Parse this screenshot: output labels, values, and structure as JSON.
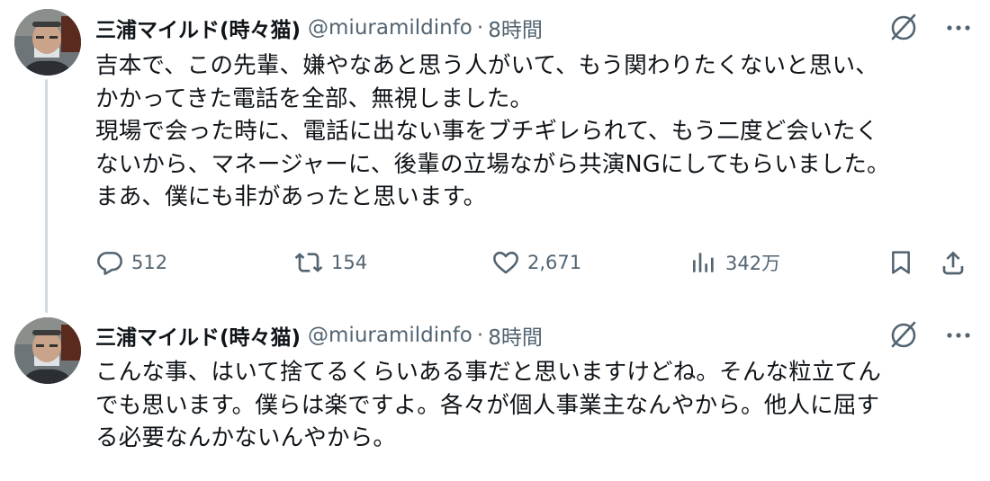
{
  "tweets": [
    {
      "name": "三浦マイルド(時々猫)",
      "handle": "@miuramildinfo",
      "separator": "·",
      "time": "8時間",
      "body": "吉本で、この先輩、嫌やなあと思う人がいて、もう関わりたくないと思い、\nかかってきた電話を全部、無視しました。\n現場で会った時に、電話に出ない事をブチギレられて、もう二度ど会いたく\nないから、マネージャーに、後輩の立場ながら共演NGにしてもらいました。\nまあ、僕にも非があったと思います。",
      "replies": "512",
      "retweets": "154",
      "likes": "2,671",
      "views": "342万"
    },
    {
      "name": "三浦マイルド(時々猫)",
      "handle": "@miuramildinfo",
      "separator": "·",
      "time": "8時間",
      "body": "こんな事、はいて捨てるくらいある事だと思いますけどね。そんな粒立てん\nでも思います。僕らは楽ですよ。各々が個人事業主なんやから。他人に屈す\nる必要なんかないんやから。"
    }
  ],
  "icons": {
    "reply": "reply-icon",
    "retweet": "retweet-icon",
    "like": "heart-icon",
    "views": "analytics-icon",
    "bookmark": "bookmark-icon",
    "share": "share-icon",
    "grok": "grok-icon",
    "more": "more-icon"
  },
  "colors": {
    "text": "#0f1419",
    "secondary": "#536471",
    "thread_line": "#cfd9de",
    "background": "#ffffff"
  }
}
